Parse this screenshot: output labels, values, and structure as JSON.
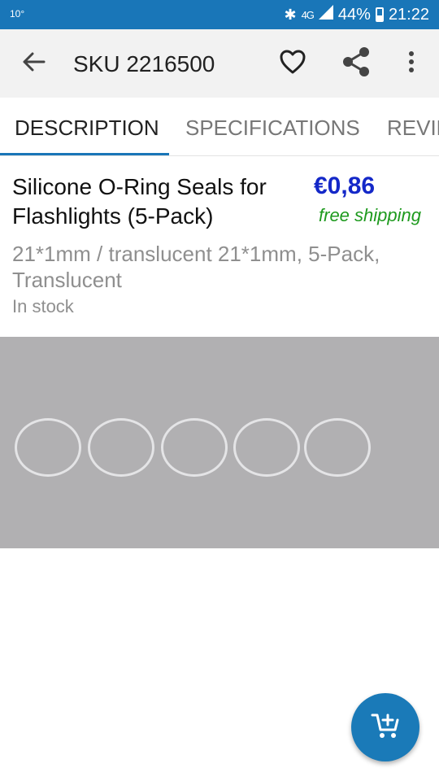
{
  "status_bar": {
    "left_text": "10°",
    "signal_label": "4G",
    "battery": "44%",
    "time": "21:22"
  },
  "app_bar": {
    "title": "SKU 2216500",
    "icons": [
      "back-arrow-icon",
      "heart-outline-icon",
      "share-icon",
      "more-vert-icon"
    ]
  },
  "tabs": [
    {
      "label": "DESCRIPTION",
      "active": true
    },
    {
      "label": "SPECIFICATIONS",
      "active": false
    },
    {
      "label": "REVIEWS",
      "active": false
    }
  ],
  "product": {
    "title": "Silicone O-Ring Seals for Flashlights (5-Pack)",
    "price": "€0,86",
    "shipping": "free shipping",
    "variant": "21*1mm / translucent 21*1mm, 5-Pack, Translucent",
    "stock": "In stock"
  },
  "colors": {
    "primary": "#1976b8",
    "price": "#1428c8",
    "shipping": "#1e9a1e",
    "image_bg": "#b1b0b2"
  },
  "fab": {
    "icon": "add-to-cart-icon"
  }
}
